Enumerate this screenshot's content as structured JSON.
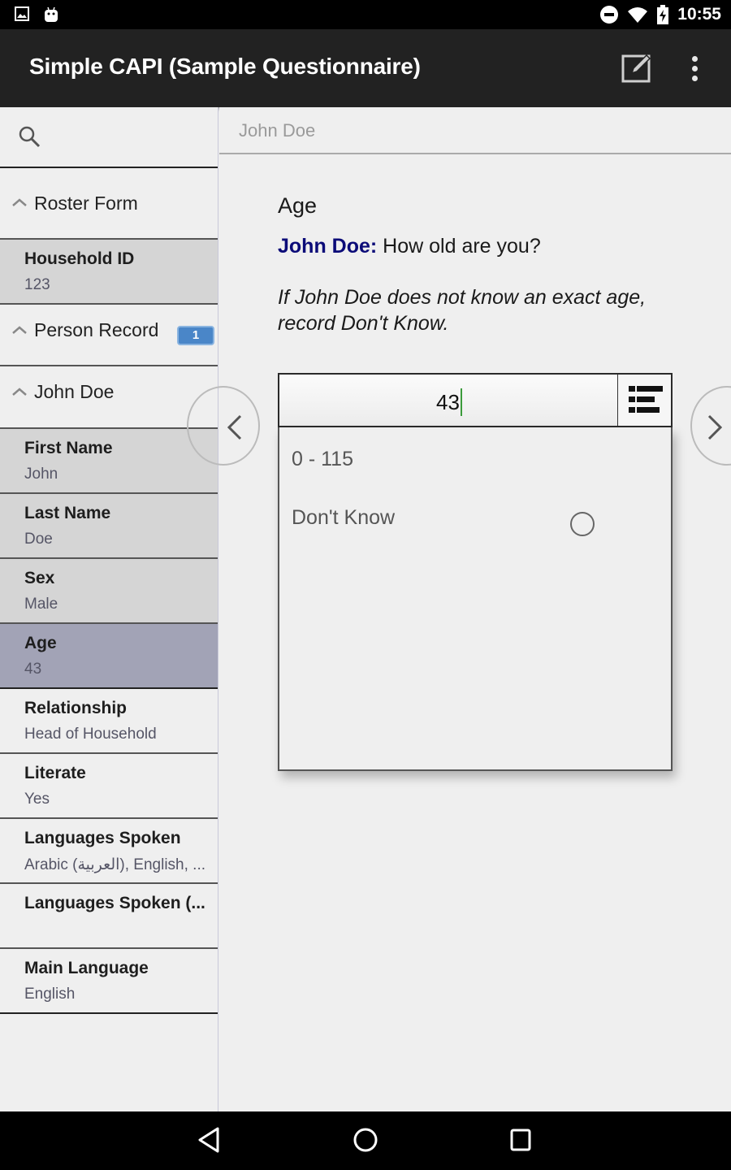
{
  "status_bar": {
    "time": "10:55",
    "left_icons": [
      "image-notification-icon",
      "android-debug-icon"
    ],
    "right_icons": [
      "do-not-disturb-icon",
      "wifi-icon",
      "battery-charging-icon"
    ]
  },
  "app_bar": {
    "title": "Simple CAPI (Sample Questionnaire)",
    "actions": [
      "edit-icon",
      "overflow-menu-icon"
    ]
  },
  "sidebar": {
    "search_icon": "search-icon",
    "groups": {
      "roster_form": "Roster Form",
      "person_record": "Person Record",
      "person_record_count": "1",
      "john_doe": "John Doe"
    },
    "household": {
      "label": "Household ID",
      "value": "123"
    },
    "fields": [
      {
        "label": "First Name",
        "value": "John",
        "state": "filled"
      },
      {
        "label": "Last Name",
        "value": "Doe",
        "state": "filled"
      },
      {
        "label": "Sex",
        "value": "Male",
        "state": "filled"
      },
      {
        "label": "Age",
        "value": "43",
        "state": "current"
      },
      {
        "label": "Relationship",
        "value": "Head of Household",
        "state": "empty"
      },
      {
        "label": "Literate",
        "value": "Yes",
        "state": "empty"
      },
      {
        "label": "Languages Spoken",
        "value": "Arabic (العربية), English, ...",
        "state": "empty"
      },
      {
        "label": "Languages Spoken (...",
        "value": "",
        "state": "empty"
      },
      {
        "label": "Main Language",
        "value": "English",
        "state": "empty"
      }
    ]
  },
  "main": {
    "breadcrumb": "John Doe",
    "question": {
      "title": "Age",
      "respondent": "John Doe:",
      "text": "How old are you?",
      "instruction": "If John Doe does not know an exact age, record Don't Know."
    },
    "input": {
      "value": "43"
    },
    "dropdown": {
      "range": "0 - 115",
      "options": [
        {
          "label": "Don't Know",
          "selected": false
        }
      ]
    }
  },
  "nav_bar": {
    "buttons": [
      "back-icon",
      "home-icon",
      "recents-icon"
    ]
  }
}
